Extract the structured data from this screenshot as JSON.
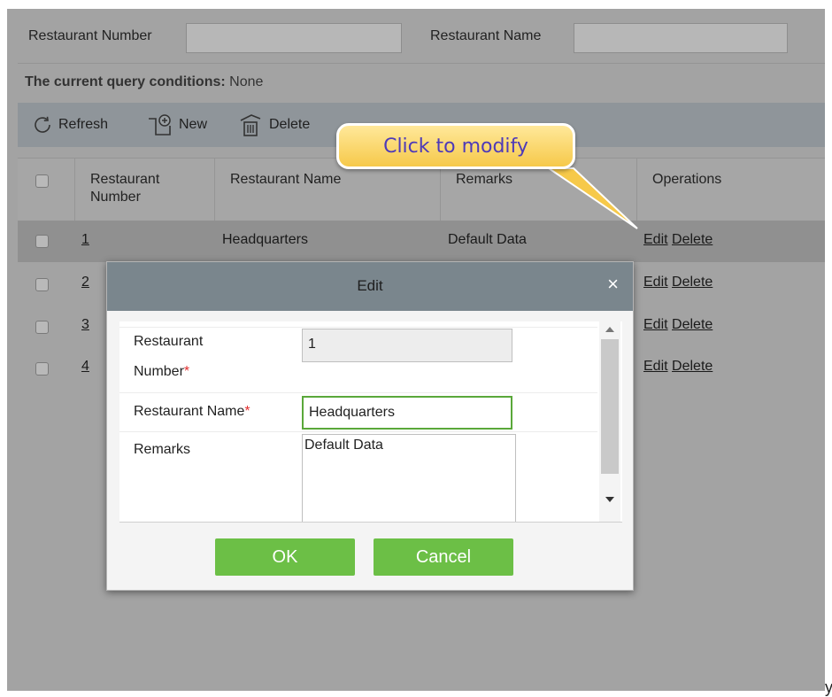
{
  "query": {
    "restaurant_number_label": "Restaurant Number",
    "restaurant_number_value": "",
    "restaurant_name_label": "Restaurant Name",
    "restaurant_name_value": "",
    "conditions_label": "The current query conditions:",
    "conditions_value": "None"
  },
  "toolbar": {
    "refresh_label": "Refresh",
    "new_label": "New",
    "delete_label": "Delete"
  },
  "callout": {
    "text": "Click to modify"
  },
  "table": {
    "headers": {
      "number_line1": "Restaurant",
      "number_line2": "Number",
      "name": "Restaurant Name",
      "remarks": "Remarks",
      "operations": "Operations"
    },
    "rows": [
      {
        "number": "1",
        "name": "Headquarters",
        "remarks": "Default Data",
        "edit": "Edit",
        "delete": "Delete"
      },
      {
        "number": "2",
        "name": "",
        "remarks": "",
        "edit": "Edit",
        "delete": "Delete"
      },
      {
        "number": "3",
        "name": "",
        "remarks": "",
        "edit": "Edit",
        "delete": "Delete"
      },
      {
        "number": "4",
        "name": "",
        "remarks": "",
        "edit": "Edit",
        "delete": "Delete"
      }
    ]
  },
  "modal": {
    "title": "Edit",
    "close": "×",
    "number_label_line1": "Restaurant",
    "number_label_line2": "Number",
    "number_value": "1",
    "name_label": "Restaurant Name",
    "name_value": "Headquarters",
    "remarks_label": "Remarks",
    "remarks_value": "Default Data",
    "required_mark": "*",
    "ok_label": "OK",
    "cancel_label": "Cancel"
  },
  "trailing_char": "y",
  "colors": {
    "ok_button": "#6cbf46",
    "required": "#e23030",
    "callout_text": "#4e3ab8",
    "callout_fill": "#f6c94a"
  }
}
